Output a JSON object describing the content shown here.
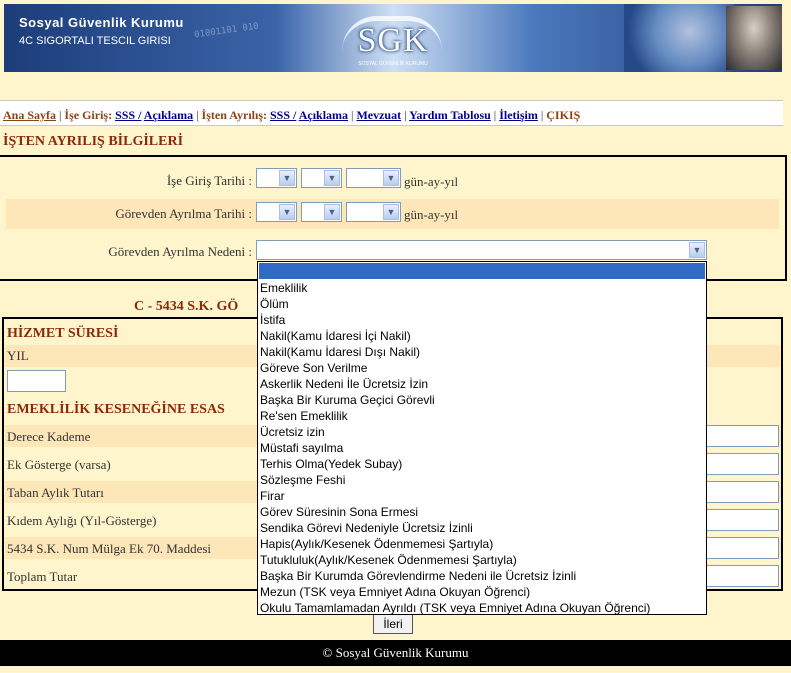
{
  "banner": {
    "org_name": "Sosyal Güvenlik Kurumu",
    "subtitle": "4C SIGORTALI TESCIL GIRISI",
    "logo_text": "SGK",
    "logo_small": "SOSYAL GÜVENLİK KURUMU",
    "binary_text": "01001101 010"
  },
  "nav": {
    "home": "Ana Sayfa",
    "entry_label": "İşe Giriş:",
    "entry_sss": "SSS /",
    "entry_desc": "Açıklama",
    "exit_label": "İşten Ayrılış:",
    "exit_sss": "SSS /",
    "exit_desc": "Açıklama",
    "legislation": "Mevzuat",
    "help_table": "Yardım Tablosu",
    "contact": "İletişim",
    "logout": "ÇIKIŞ",
    "sep": "|"
  },
  "exit_info": {
    "title": "İŞTEN AYRILIŞ BİLGİLERİ",
    "entry_date_label": "İşe Giriş Tarihi :",
    "leave_date_label": "Görevden Ayrılma Tarihi :",
    "reason_label": "Görevden Ayrılma Nedeni :",
    "date_format": "gün-ay-yıl"
  },
  "reason_options": [
    "Emeklilik",
    "Ölüm",
    "İstifa",
    "Nakil(Kamu İdaresi İçi Nakil)",
    "Nakil(Kamu İdaresi Dışı Nakil)",
    "Göreve Son Verilme",
    "Askerlik Nedeni İle Ücretsiz İzin",
    "Başka Bir Kuruma Geçici Görevli",
    "Re'sen Emeklilik",
    "Ücretsiz izin",
    "Müstafi sayılma",
    "Terhis Olma(Yedek Subay)",
    "Sözleşme Feshi",
    "Firar",
    "Görev Süresinin Sona Ermesi",
    "Sendika Görevi Nedeniyle Ücretsiz İzinli",
    "Hapis(Aylık/Kesenek Ödenmemesi Şartıyla)",
    "Tutukluluk(Aylık/Kesenek Ödenmemesi Şartıyla)",
    "Başka Bir Kurumda Görevlendirme Nedeni ile Ücretsiz İzinli",
    "Mezun (TSK veya Emniyet Adına Okuyan Öğrenci)",
    "Okulu Tamamlamadan Ayrıldı (TSK veya Emniyet Adına Okuyan Öğrenci)"
  ],
  "section_c": {
    "title": "C - 5434 S.K. GÖ",
    "service_heading": "HİZMET SÜRESİ",
    "year_label": "YIL",
    "pension_heading": "EMEKLİLİK KESENEĞİNE ESAS",
    "grade_label": "Derece Kademe",
    "extra_indicator_label": "Ek Gösterge (varsa)",
    "base_salary_label": "Taban Aylık Tutarı",
    "seniority_label": "Kıdem Aylığı (Yıl-Gösterge)",
    "article_label": "5434 S.K. Num Mülga Ek 70. Maddesi",
    "total_label": "Toplam Tutar"
  },
  "buttons": {
    "next": "İleri"
  },
  "footer": {
    "copyright": "© Sosyal Güvenlik Kurumu"
  }
}
